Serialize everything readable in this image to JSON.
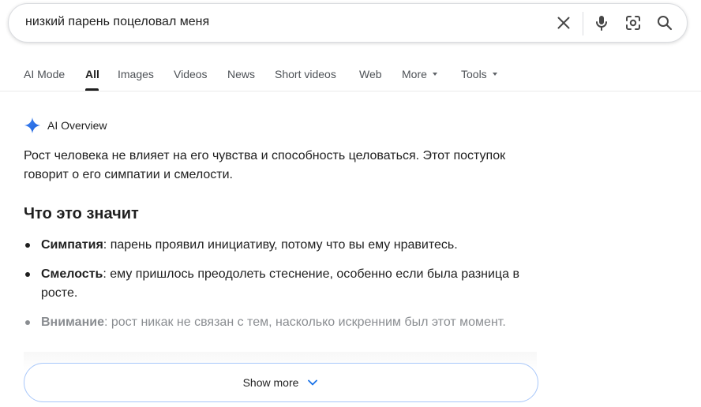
{
  "search": {
    "query": "низкий парень поцеловал меня"
  },
  "tabs": [
    {
      "label": "AI Mode"
    },
    {
      "label": "All",
      "active": true
    },
    {
      "label": "Images"
    },
    {
      "label": "Videos"
    },
    {
      "label": "News"
    },
    {
      "label": "Short videos"
    },
    {
      "label": "Web"
    },
    {
      "label": "More",
      "has_caret": true
    },
    {
      "label": "Tools",
      "has_caret": true
    }
  ],
  "icons": {
    "clear": "close-icon",
    "voice": "microphone-icon",
    "lens": "camera-lens-icon",
    "search": "search-icon",
    "ai": "sparkle-icon",
    "expand": "chevron-down-icon"
  },
  "ai_overview": {
    "title": "AI Overview",
    "summary": "Рост человека не влияет на его чувства и способность целоваться. Этот поступок говорит о его симпатии и смелости.",
    "section_heading": "Что это значит",
    "bullets": [
      {
        "term": "Симпатия",
        "text": ": парень проявил инициативу, потому что вы ему нравитесь."
      },
      {
        "term": "Смелость",
        "text": ": ему пришлось преодолеть стеснение, особенно если была разница в росте."
      },
      {
        "term": "Внимание",
        "text": ": рост никак не связан с тем, насколько искренним был этот момент."
      }
    ],
    "show_more_label": "Show more"
  },
  "colors": {
    "accent_blue": "#1a73e8",
    "show_more_border": "#a8c7fa",
    "text_primary": "#1f1f1f",
    "text_secondary": "#4d5156"
  }
}
